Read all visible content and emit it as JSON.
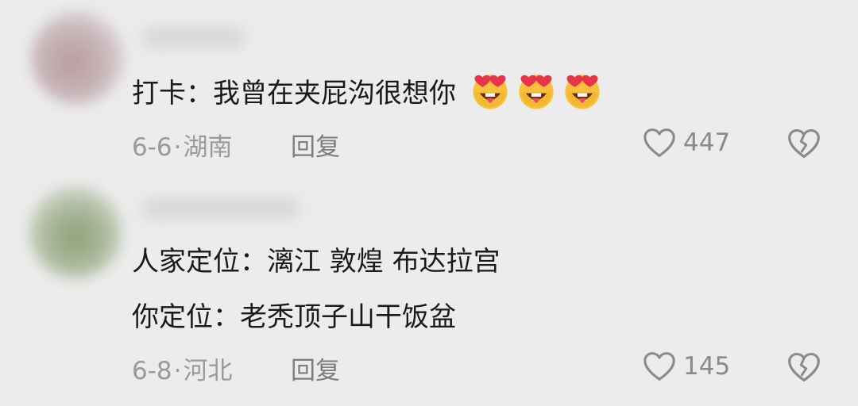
{
  "comments": [
    {
      "text": "打卡：我曾在夹屁沟很想你",
      "emoji_count": 3,
      "date": "6-6",
      "location": "湖南",
      "reply_label": "回复",
      "likes": "447"
    },
    {
      "text_line1": "人家定位：漓江  敦煌  布达拉宫",
      "text_line2": "你定位：老秃顶子山干饭盆",
      "date": "6-8",
      "location": "河北",
      "reply_label": "回复",
      "likes": "145"
    }
  ],
  "separator": "·",
  "icons": {
    "emoji": "heart-eyes-tongue-emoji",
    "like": "heart-outline-icon",
    "dislike": "broken-heart-icon"
  },
  "colors": {
    "background": "#ececec",
    "text": "#1a1a1a",
    "meta": "#9a9a9a",
    "emoji_face": "#f7c13a",
    "emoji_heart": "#e8344a"
  }
}
